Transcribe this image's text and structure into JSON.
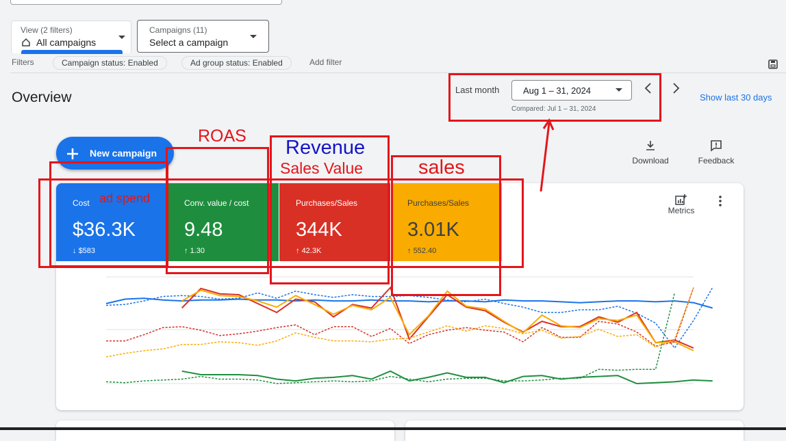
{
  "filters_bar": {
    "view_small": "View (2 filters)",
    "view_main": "All campaigns",
    "campaigns_small": "Campaigns (11)",
    "campaigns_main": "Select a campaign",
    "filters_label": "Filters",
    "chips": [
      "Campaign status: Enabled",
      "Ad group status: Enabled"
    ],
    "add_filter": "Add filter"
  },
  "overview": {
    "title": "Overview",
    "date_label": "Last month",
    "date_range": "Aug 1 – 31, 2024",
    "compared": "Compared: Jul 1 – 31, 2024",
    "show_last": "Show last 30 days",
    "new_campaign": "New campaign",
    "download": "Download",
    "feedback": "Feedback",
    "metrics": "Metrics"
  },
  "tiles": [
    {
      "label": "Cost",
      "value": "$36.3K",
      "delta": "$583",
      "direction": "down",
      "color": "#1a73e8"
    },
    {
      "label": "Conv. value / cost",
      "value": "9.48",
      "delta": "1.30",
      "direction": "up",
      "color": "#1e8e3e"
    },
    {
      "label": "Purchases/Sales",
      "value": "344K",
      "delta": "42.3K",
      "direction": "up",
      "color": "#d93025"
    },
    {
      "label": "Purchases/Sales",
      "value": "3.01K",
      "delta": "552.40",
      "direction": "up",
      "color": "#f9ab00"
    }
  ],
  "annotations": {
    "ad_spend": "ad spend",
    "roas": "ROAS",
    "revenue": "Revenue",
    "sales_value": "Sales Value",
    "sales": "sales"
  },
  "chart_data": {
    "type": "line",
    "series": [
      {
        "color": "#1a73e8",
        "style": "solid",
        "values": [
          70,
          75,
          76,
          74,
          73,
          74,
          74,
          75,
          74,
          74,
          73,
          74,
          73,
          73,
          74,
          73,
          73,
          72,
          73,
          73,
          72,
          74,
          73,
          73,
          72,
          71,
          72,
          73,
          73,
          72,
          73,
          71,
          65
        ]
      },
      {
        "color": "#1a73e8",
        "style": "dashed",
        "values": [
          68,
          69,
          73,
          78,
          79,
          78,
          75,
          76,
          82,
          76,
          84,
          80,
          77,
          80,
          78,
          78,
          79,
          77,
          74,
          72,
          75,
          70,
          66,
          60,
          60,
          63,
          63,
          67,
          59,
          48,
          20,
          51,
          88
        ]
      },
      {
        "color": "#d93025",
        "style": "solid",
        "values": [
          null,
          null,
          null,
          null,
          65,
          87,
          81,
          80,
          70,
          60,
          75,
          72,
          55,
          69,
          65,
          88,
          30,
          55,
          80,
          66,
          62,
          49,
          38,
          50,
          44,
          44,
          55,
          49,
          60,
          26,
          29,
          20
        ]
      },
      {
        "color": "#f9ab00",
        "style": "solid",
        "values": [
          null,
          null,
          null,
          null,
          73,
          85,
          79,
          78,
          73,
          66,
          79,
          69,
          58,
          68,
          63,
          77,
          35,
          56,
          84,
          67,
          64,
          50,
          37,
          57,
          45,
          43,
          53,
          51,
          57,
          26,
          27,
          17
        ]
      },
      {
        "color": "#d93025",
        "style": "dashed",
        "values": [
          28,
          28,
          35,
          43,
          44,
          40,
          34,
          36,
          39,
          43,
          46,
          35,
          44,
          44,
          33,
          42,
          25,
          35,
          40,
          43,
          40,
          38,
          27,
          43,
          32,
          32,
          50,
          47,
          38,
          22,
          27,
          88
        ]
      },
      {
        "color": "#f9ab00",
        "style": "dashed",
        "values": [
          10,
          14,
          17,
          19,
          24,
          24,
          27,
          26,
          23,
          28,
          37,
          32,
          28,
          28,
          27,
          30,
          31,
          38,
          45,
          39,
          45,
          42,
          36,
          40,
          31,
          33,
          41,
          33,
          35,
          21,
          30,
          88
        ]
      },
      {
        "color": "#1e8e3e",
        "style": "solid",
        "values": [
          null,
          null,
          null,
          null,
          -6,
          -10,
          -10,
          -10,
          -11,
          -15,
          -17,
          -14,
          -13,
          -11,
          -15,
          -6,
          -17,
          -13,
          -8,
          -13,
          -13,
          -19,
          -12,
          -11,
          -15,
          -13,
          -12,
          -11,
          -20,
          -19,
          -18,
          -16,
          -17
        ]
      },
      {
        "color": "#1e8e3e",
        "style": "dashed",
        "values": [
          -18,
          -19,
          -17,
          -16,
          -15,
          -12,
          -15,
          -15,
          -16,
          -20,
          -19,
          -18,
          -17,
          -18,
          -17,
          -12,
          -15,
          -18,
          -15,
          -14,
          -14,
          -17,
          -17,
          -16,
          -14,
          -14,
          -4,
          -5,
          -4,
          -4,
          82,
          null
        ]
      }
    ]
  }
}
